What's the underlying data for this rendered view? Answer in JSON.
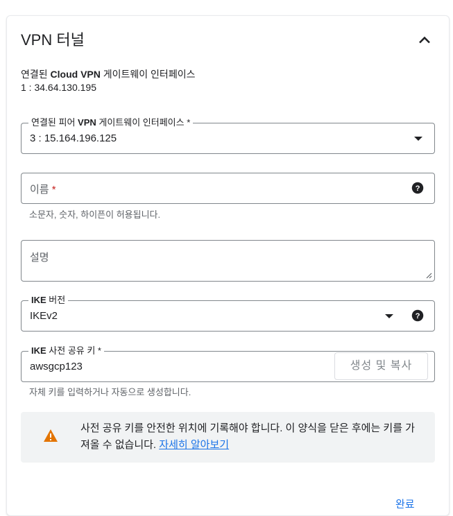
{
  "section": {
    "title": "VPN 터널"
  },
  "cloud_gateway": {
    "label_prefix": "연결된 ",
    "label_bold": "Cloud VPN",
    "label_suffix": " 게이트웨이 인터페이스",
    "value": "1 : 34.64.130.195"
  },
  "peer_gateway": {
    "label_prefix": "연결된 피어 ",
    "label_bold": "VPN",
    "label_suffix": " 게이트웨이 인터페이스 *",
    "value": "3 : 15.164.196.125"
  },
  "name_field": {
    "placeholder": "이름",
    "required_mark": "*",
    "helper": "소문자, 숫자, 하이픈이 허용됩니다."
  },
  "description_field": {
    "placeholder": "설명"
  },
  "ike_version": {
    "label_bold": "IKE",
    "label_suffix": " 버전",
    "value": "IKEv2"
  },
  "ike_key": {
    "label_bold": "IKE",
    "label_suffix": " 사전 공유 키 *",
    "value": "awsgcp123",
    "generate_button": "생성 및 복사",
    "helper": "자체 키를 입력하거나 자동으로 생성합니다."
  },
  "warning": {
    "text": "사전 공유 키를 안전한 위치에 기록해야 합니다. 이 양식을 닫은 후에는 키를 가져올 수 없습니다.",
    "link": "자세히 알아보기",
    "icon": "warning-icon",
    "icon_color": "#e37400"
  },
  "actions": {
    "done": "완료"
  },
  "colors": {
    "accent": "#1a73e8",
    "required": "#c5221f"
  }
}
